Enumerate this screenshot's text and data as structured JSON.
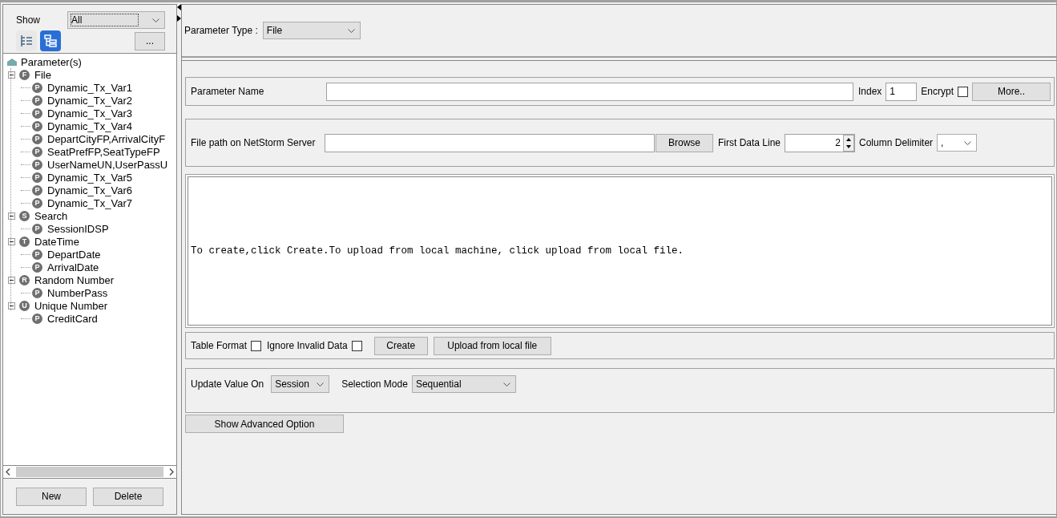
{
  "left_panel": {
    "show_label": "Show",
    "show_value": "All",
    "more_button": "...",
    "view_toggles": [
      {
        "kind": "list",
        "selected": false
      },
      {
        "kind": "tree",
        "selected": true
      }
    ],
    "tree": {
      "label": "Parameter(s)",
      "children": [
        {
          "badge": "F",
          "label": "File",
          "expanded": true,
          "children": [
            {
              "badge": "P",
              "label": "Dynamic_Tx_Var1"
            },
            {
              "badge": "P",
              "label": "Dynamic_Tx_Var2"
            },
            {
              "badge": "P",
              "label": "Dynamic_Tx_Var3"
            },
            {
              "badge": "P",
              "label": "Dynamic_Tx_Var4"
            },
            {
              "badge": "P",
              "label": "DepartCityFP,ArrivalCityF"
            },
            {
              "badge": "P",
              "label": "SeatPrefFP,SeatTypeFP"
            },
            {
              "badge": "P",
              "label": "UserNameUN,UserPassU"
            },
            {
              "badge": "P",
              "label": "Dynamic_Tx_Var5"
            },
            {
              "badge": "P",
              "label": "Dynamic_Tx_Var6"
            },
            {
              "badge": "P",
              "label": "Dynamic_Tx_Var7"
            }
          ]
        },
        {
          "badge": "S",
          "label": "Search",
          "expanded": true,
          "children": [
            {
              "badge": "P",
              "label": "SessionIDSP"
            }
          ]
        },
        {
          "badge": "T",
          "label": "DateTime",
          "expanded": true,
          "children": [
            {
              "badge": "P",
              "label": "DepartDate"
            },
            {
              "badge": "P",
              "label": "ArrivalDate"
            }
          ]
        },
        {
          "badge": "R",
          "label": "Random Number",
          "expanded": true,
          "children": [
            {
              "badge": "P",
              "label": "NumberPass"
            }
          ]
        },
        {
          "badge": "U",
          "label": "Unique Number",
          "expanded": true,
          "children": [
            {
              "badge": "P",
              "label": "CreditCard"
            }
          ]
        }
      ]
    },
    "buttons": [
      "New",
      "Delete"
    ]
  },
  "parameter_type": {
    "label": "Parameter Type :",
    "value": "File"
  },
  "name_row": {
    "label": "Parameter Name",
    "index_label": "Index",
    "index_value": "1",
    "encrypt_label": "Encrypt",
    "encrypt_checked": false,
    "more_button": "More.."
  },
  "file_row": {
    "label": "File path on NetStorm Server",
    "browse_button": "Browse",
    "first_line_label": "First Data Line",
    "first_line_value": "2",
    "delimiter_label": "Column Delimiter",
    "delimiter_value": ","
  },
  "message": "To create,click Create.To upload from local machine, click upload from local file.",
  "options_row": {
    "table_format_label": "Table Format",
    "table_format_checked": false,
    "ignore_label": "Ignore Invalid Data",
    "ignore_checked": false,
    "create_button": "Create",
    "upload_button": "Upload from local file"
  },
  "update_row": {
    "update_label": "Update Value On",
    "update_value": "Session",
    "mode_label": "Selection Mode",
    "mode_value": "Sequential"
  },
  "advanced_button": "Show Advanced Option"
}
